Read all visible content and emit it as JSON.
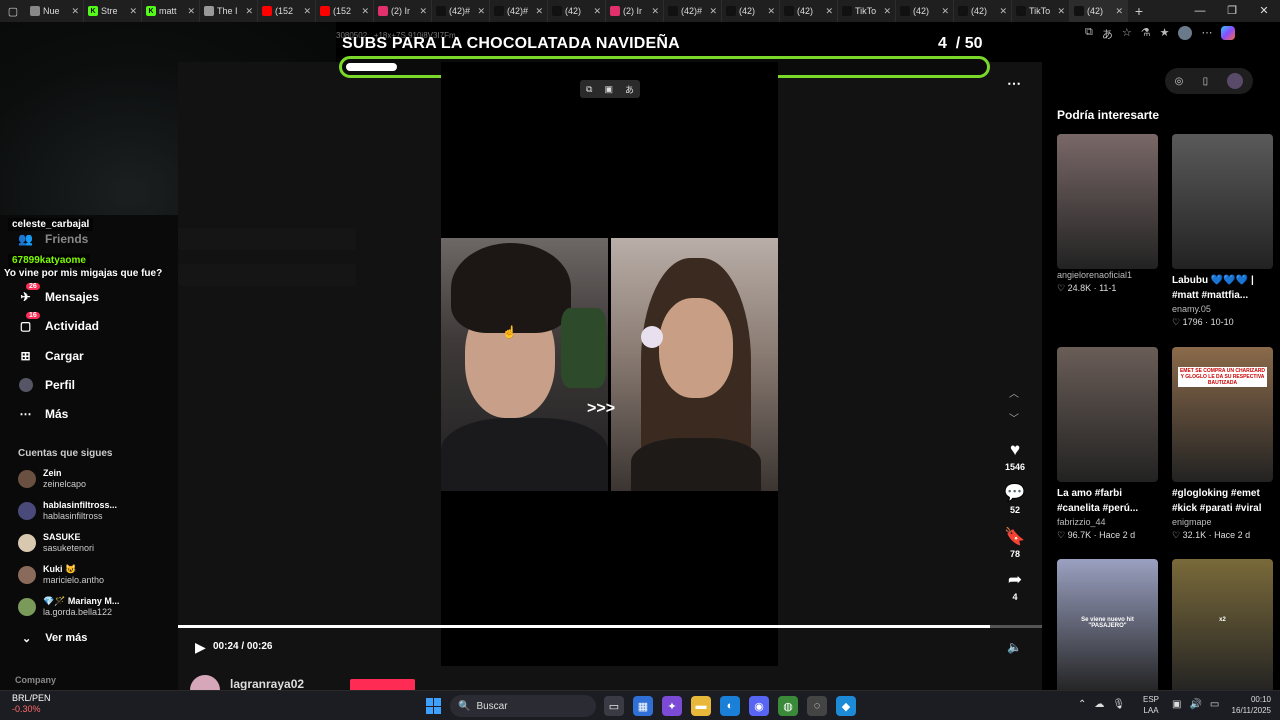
{
  "browser": {
    "tabs": [
      {
        "title": "Nue",
        "fav_color": "#888"
      },
      {
        "title": "Stre",
        "fav_color": "#53fc18",
        "fav_glyph": "K"
      },
      {
        "title": "matt",
        "fav_color": "#53fc18",
        "fav_glyph": "K"
      },
      {
        "title": "The I",
        "fav_color": "#999"
      },
      {
        "title": "(152",
        "fav_color": "#ff0000"
      },
      {
        "title": "(152",
        "fav_color": "#ff0000"
      },
      {
        "title": "(2) Ir",
        "fav_color": "#e1306c"
      },
      {
        "title": "(42)#",
        "fav_color": "#111"
      },
      {
        "title": "(42)#",
        "fav_color": "#111"
      },
      {
        "title": "(42)",
        "fav_color": "#111"
      },
      {
        "title": "(2) Ir",
        "fav_color": "#e1306c"
      },
      {
        "title": "(42)#",
        "fav_color": "#111"
      },
      {
        "title": "(42)",
        "fav_color": "#111"
      },
      {
        "title": "(42)",
        "fav_color": "#111"
      },
      {
        "title": "TikTo",
        "fav_color": "#111"
      },
      {
        "title": "(42)",
        "fav_color": "#111"
      },
      {
        "title": "(42)",
        "fav_color": "#111"
      },
      {
        "title": "TikTo",
        "fav_color": "#111"
      },
      {
        "title": "(42)",
        "fav_color": "#111",
        "active": true
      }
    ],
    "url_fragment": "3080502...+18x+7S.910i8V3I7Fm"
  },
  "goal": {
    "title": "SUBS PARA LA CHOCOLATADA NAVIDEÑA",
    "current": "4",
    "total": "/ 50",
    "fraction": 0.08
  },
  "chat": [
    {
      "user": "celeste_carbajal",
      "color": "#ffffff"
    },
    {
      "user": "67899katyaome",
      "color": "#7cfc00",
      "message": "Yo vine por mis migajas que fue?"
    }
  ],
  "nav": {
    "friends": "Friends",
    "items": [
      {
        "label": "Mensajes",
        "badge": "26",
        "icon": "send-icon"
      },
      {
        "label": "Actividad",
        "badge": "16",
        "icon": "bell-icon"
      },
      {
        "label": "Cargar",
        "icon": "upload-icon"
      },
      {
        "label": "Perfil",
        "icon": "profile-icon"
      },
      {
        "label": "Más",
        "icon": "more-icon"
      }
    ],
    "following_title": "Cuentas que sigues",
    "following": [
      {
        "name": "Zein",
        "handle": "zeinelcapo",
        "color": "#6a5040"
      },
      {
        "name": "hablasinfiltross...",
        "handle": "hablasinfiltross",
        "color": "#4a4a7a"
      },
      {
        "name": "SASUKE",
        "handle": "sasuketenori",
        "color": "#d8c8b0"
      },
      {
        "name": "Kuki 😺",
        "handle": "maricielo.antho",
        "color": "#8a6a5a"
      },
      {
        "name": "💎🪄 Mariany M...",
        "handle": "la.gorda.bella122",
        "color": "#7a9a5a"
      }
    ],
    "see_more": "Ver más",
    "company": "Company"
  },
  "player": {
    "time": "00:24 / 00:26",
    "progress": 0.94,
    "overlay_text": ">>>",
    "author": "lagranraya02"
  },
  "actions": {
    "likes": "1546",
    "comments": "52",
    "saves": "78",
    "shares": "4"
  },
  "recommendations": {
    "title": "Podría interesarte",
    "cards": [
      {
        "caption": "",
        "author": "angielorenaoficial1",
        "meta": "♡ 24.8K · 11-1",
        "bg": "#7a6868"
      },
      {
        "caption": "Labubu 💙💙💙 | #matt #mattfia...",
        "author": "enamy.05",
        "meta": "♡ 1796 · 10-10",
        "bg": "#5a5a5a"
      },
      {
        "caption": "La amo #farbi #canelita #perú...",
        "author": "fabrizzio_44",
        "meta": "♡ 96.7K · Hace 2 d",
        "bg": "#6a5d57"
      },
      {
        "caption": "#glogloking #emet #kick #parati #viral",
        "author": "enigmape",
        "meta": "♡ 32.1K · Hace 2 d",
        "bg": "#8a6a4a",
        "thumb_text": "EMET SE COMPRA UN CHARIZARD Y GLOGLO LE DA SU RESPECTIVA BAUTIZADA"
      },
      {
        "caption": "",
        "author": "",
        "meta": "",
        "bg": "#9aa0c0",
        "thumb_text2": "Se viene nuevo hit \"PASAJERO\""
      },
      {
        "caption": "",
        "author": "",
        "meta": "",
        "bg": "#7a6a3a",
        "thumb_text2": "x2"
      }
    ]
  },
  "taskbar": {
    "ticker_symbol": "BRL/PEN",
    "ticker_change": "-0.30%",
    "search": "Buscar",
    "lang": "ESP",
    "lang2": "LAA",
    "time": "00:10",
    "date": "16/11/2025"
  }
}
